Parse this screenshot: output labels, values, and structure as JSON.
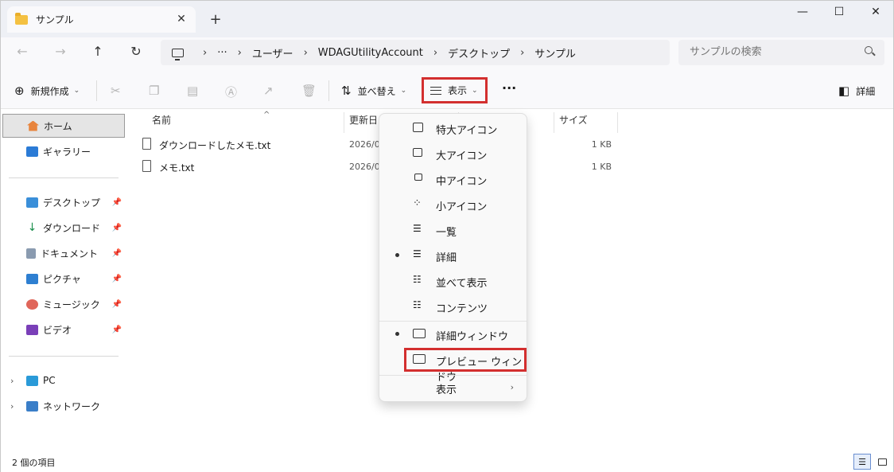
{
  "window": {
    "tab_title": "サンプル",
    "tab_close": "✕",
    "new_tab": "+",
    "minimize": "—",
    "maximize": "☐",
    "close": "✕"
  },
  "nav": {
    "back": "←",
    "forward": "→",
    "up": "↑",
    "refresh": "↻"
  },
  "address": {
    "ellipsis": "···",
    "crumbs": [
      "ユーザー",
      "WDAGUtilityAccount",
      "デスクトップ",
      "サンプル"
    ],
    "separator": "›"
  },
  "search": {
    "placeholder": "サンプルの検索"
  },
  "toolbar": {
    "new_label": "新規作成",
    "sort_label": "並べ替え",
    "view_label": "表示",
    "more": "···",
    "details_label": "詳細"
  },
  "sidebar": {
    "home": "ホーム",
    "gallery": "ギャラリー",
    "pinned": [
      "デスクトップ",
      "ダウンロード",
      "ドキュメント",
      "ピクチャ",
      "ミュージック",
      "ビデオ"
    ],
    "pc": "PC",
    "network": "ネットワーク"
  },
  "columns": {
    "name": "名前",
    "modified": "更新日",
    "size": "サイズ"
  },
  "files": [
    {
      "name": "ダウンロードしたメモ.txt",
      "date": "2026/09",
      "size": "1 KB"
    },
    {
      "name": "メモ.txt",
      "date": "2026/09",
      "size": "1 KB"
    }
  ],
  "view_menu": {
    "items": [
      "特大アイコン",
      "大アイコン",
      "中アイコン",
      "小アイコン",
      "一覧",
      "詳細",
      "並べて表示",
      "コンテンツ"
    ],
    "details_pane": "詳細ウィンドウ",
    "preview_pane": "プレビュー ウィンドウ",
    "show": "表示",
    "selected_layout": "詳細",
    "details_pane_checked": true
  },
  "status": {
    "item_count": "2 個の項目"
  },
  "colors": {
    "highlight_red": "#d32f2f",
    "accent_blue": "#0067c0"
  }
}
